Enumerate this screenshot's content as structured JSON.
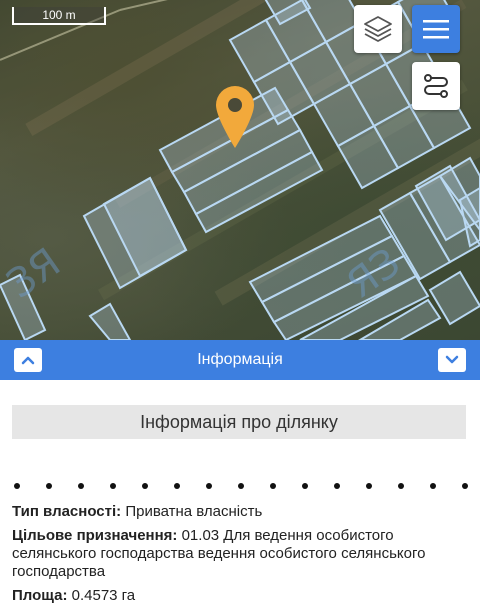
{
  "map": {
    "scale_label": "100 m",
    "icons": {
      "layers": "layers-icon",
      "menu": "hamburger-menu-icon",
      "route": "route-icon",
      "marker": "location-pin-icon"
    },
    "colors": {
      "marker": "#f2a93b",
      "parcel_outline": "#b9d8f2",
      "parcel_fill": "rgba(190,220,245,0.28)",
      "accent": "#3d7fe0"
    }
  },
  "info_panel": {
    "title": "Інформація",
    "collapse_icon": "chevron-up-icon",
    "expand_icon": "chevron-down-icon",
    "section_title": "Інформація про ділянку",
    "fields": [
      {
        "label": "Тип власності:",
        "value": " Приватна власність"
      },
      {
        "label": "Цільове призначення:",
        "value": " 01.03 Для ведення особистого селянського господарства ведення особистого селянського господарства"
      },
      {
        "label": "Площа:",
        "value": " 0.4573 га"
      }
    ]
  }
}
